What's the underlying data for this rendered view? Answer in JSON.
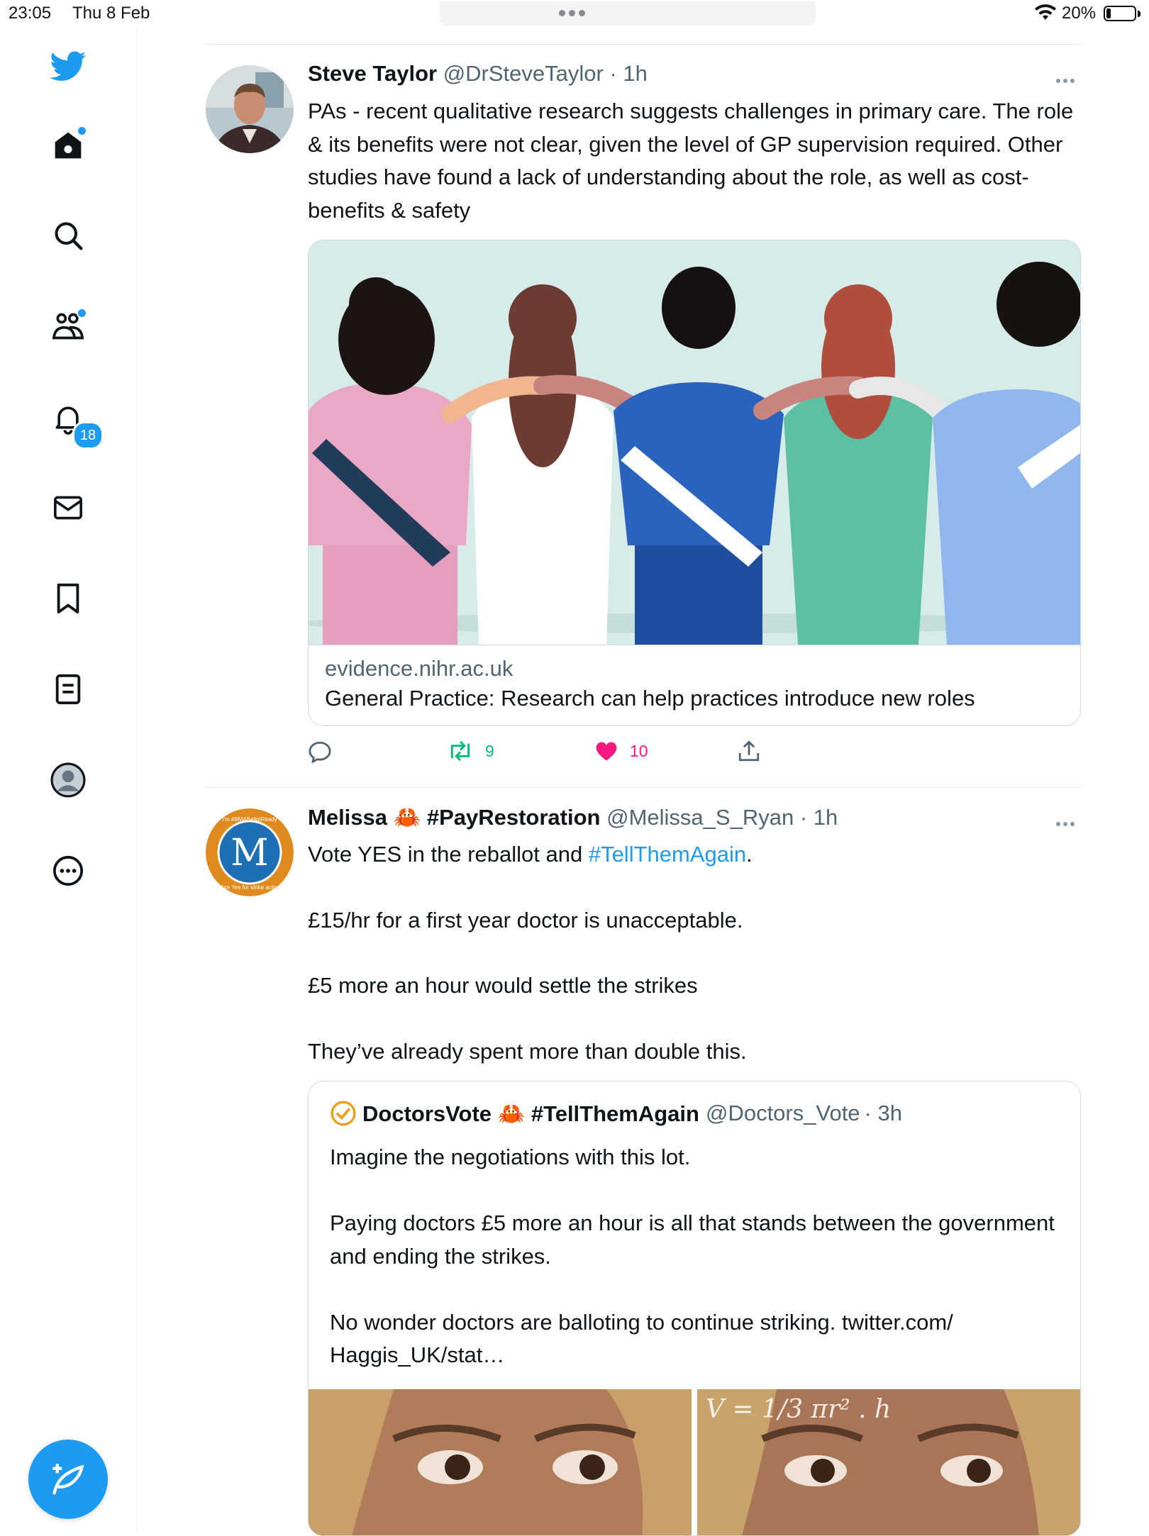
{
  "status_bar": {
    "time": "23:05",
    "date": "Thu 8 Feb",
    "battery": "20%"
  },
  "sidebar": {
    "items": [
      {
        "name": "twitter-logo",
        "icon": "bird-icon"
      },
      {
        "name": "home",
        "icon": "home-icon"
      },
      {
        "name": "explore",
        "icon": "search-icon"
      },
      {
        "name": "communities",
        "icon": "communities-icon"
      },
      {
        "name": "notifications",
        "icon": "bell-icon"
      },
      {
        "name": "messages",
        "icon": "mail-icon"
      },
      {
        "name": "bookmarks",
        "icon": "bookmark-icon"
      },
      {
        "name": "lists",
        "icon": "list-icon"
      },
      {
        "name": "profile",
        "icon": "profile-icon"
      },
      {
        "name": "more",
        "icon": "more-circle-icon"
      }
    ],
    "notifications_badge": "18",
    "compose_icon": "compose-feather-icon",
    "accent": "#1d9bf0"
  },
  "tweet1": {
    "name": "Steve Taylor",
    "handle": "@DrSteveTaylor",
    "time": "· 1h",
    "text": "PAs - recent qualitative research suggests challenges in primary care. The role & its benefits were not clear, given the level of GP supervision required. Other studies have found a lack of understanding about the role, as well as cost-benefits & safety",
    "card": {
      "domain": "evidence.nihr.ac.uk",
      "title": "General Practice: Research can help practices introduce new roles"
    },
    "retweets": "9",
    "likes": "10",
    "like_color": "#f91880",
    "retweet_color": "#00ba7c"
  },
  "tweet2": {
    "name": "Melissa 🦀 #PayRestoration",
    "handle": "@Melissa_S_Ryan",
    "time": "· 1h",
    "avatar_letter": "M",
    "avatar_ring_top": "I'm #BMABallotReady",
    "avatar_ring_bottom": "Vote Yes for strike action",
    "text_before_link": "Vote YES in the reballot and ",
    "link": "#TellThemAgain",
    "text_after_link": ".",
    "paragraphs": [
      "£15/hr for a first year doctor is unacceptable.",
      "£5 more an hour would settle the strikes",
      "They’ve already spent more than double this."
    ],
    "quote": {
      "name": "DoctorsVote 🦀 #TellThemAgain",
      "handle": "@Doctors_Vote",
      "time": "· 3h",
      "text": "Imagine the negotiations with this lot.\n\nPaying doctors £5 more an hour is all that stands between the government and ending the strikes.\n\nNo wonder doctors are balloting to continue striking. twitter.com/\nHaggis_UK/stat…",
      "image_formula": "V = 1/3 πr² . h"
    }
  }
}
